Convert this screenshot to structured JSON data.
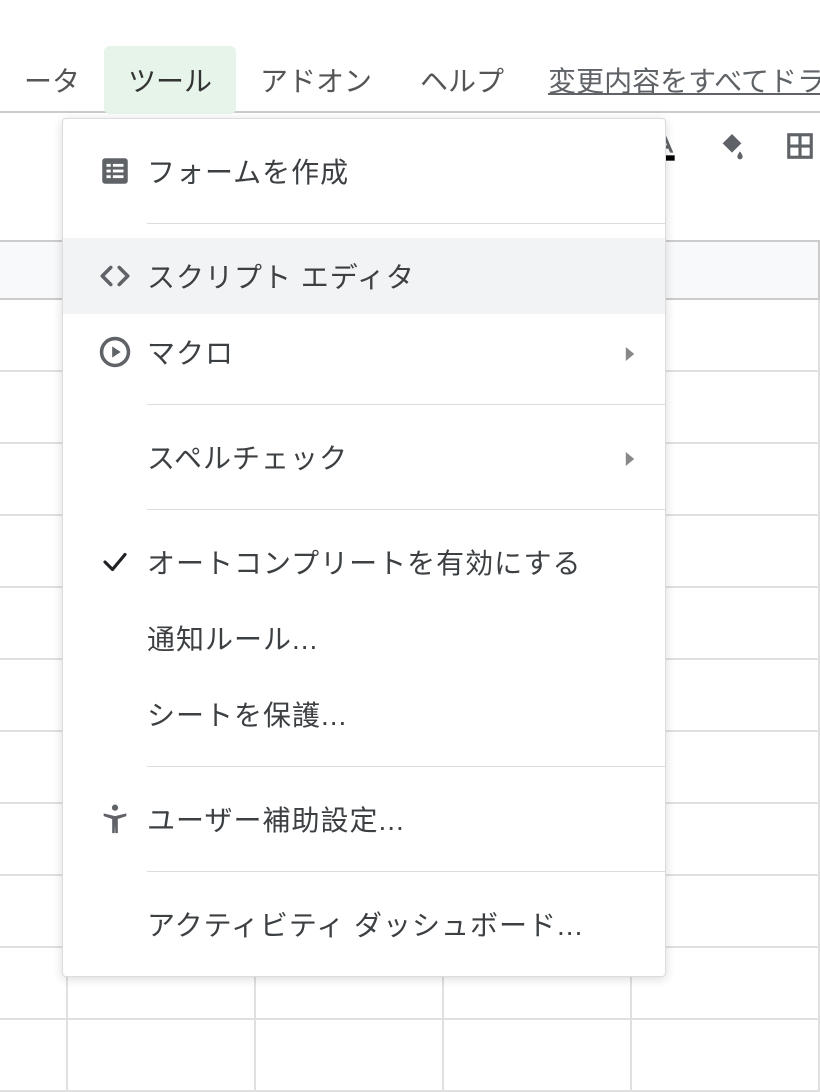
{
  "menubar": {
    "data": "ータ",
    "tools": "ツール",
    "addons": "アドオン",
    "help": "ヘルプ",
    "status": "変更内容をすべてドライ"
  },
  "menu": {
    "create_form": "フォームを作成",
    "script_editor": "スクリプト エディタ",
    "macros": "マクロ",
    "spell_check": "スペルチェック",
    "autocomplete": "オートコンプリートを有効にする",
    "notification_rules": "通知ルール...",
    "protect_sheet": "シートを保護...",
    "accessibility": "ユーザー補助設定...",
    "activity_dashboard": "アクティビティ ダッシュボード..."
  }
}
